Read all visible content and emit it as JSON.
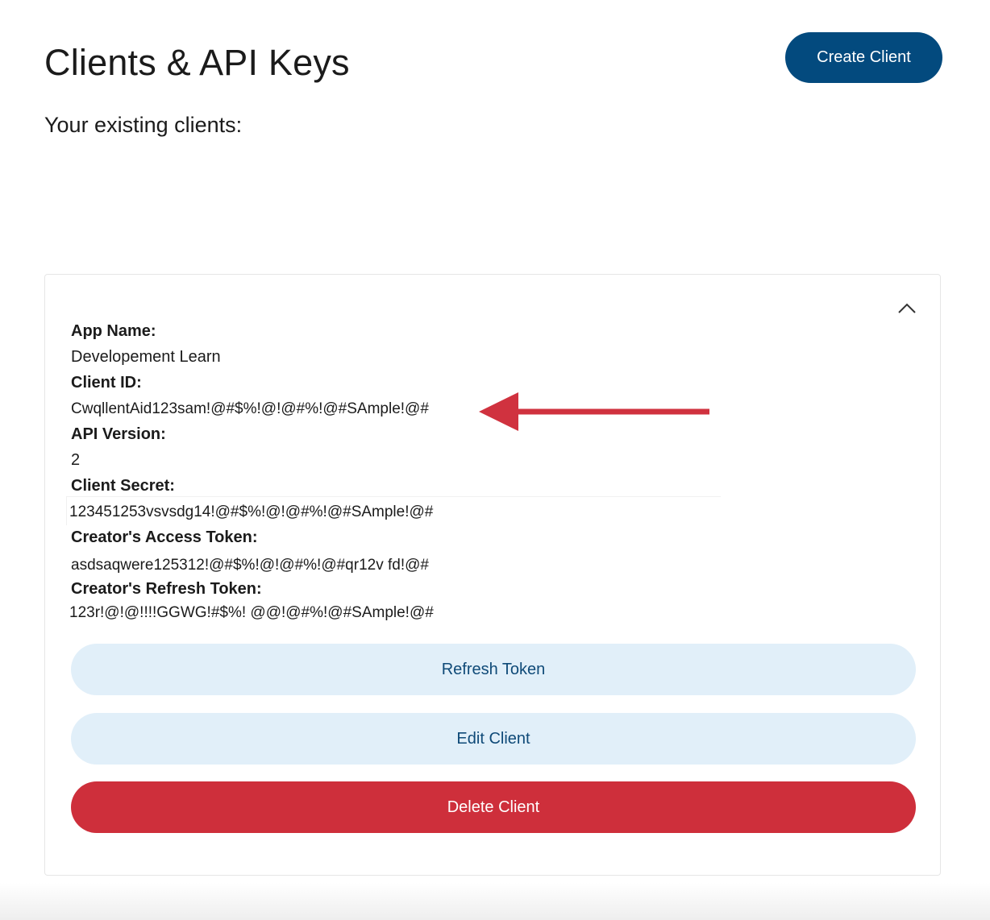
{
  "header": {
    "title": "Clients & API Keys",
    "create_label": "Create Client"
  },
  "subtitle": "Your existing clients:",
  "client_card": {
    "fields": [
      {
        "label": "App Name:",
        "value": "Developement Learn"
      },
      {
        "label": "Client ID:",
        "value": "CwqllentAid123sam!@#$%!@!@#%!@#SAmple!@#"
      },
      {
        "label": "API Version:",
        "value": "2"
      },
      {
        "label": "Client Secret:",
        "value": "123451253vsvsdg14!@#$%!@!@#%!@#SAmple!@#"
      },
      {
        "label": "Creator's Access Token:",
        "value": "asdsaqwere125312!@#$%!@!@#%!@#qr12v fd!@#"
      },
      {
        "label": "Creator's Refresh Token:",
        "value": "123r!@!@!!!!GGWG!#$%! @@!@#%!@#SAmple!@#"
      }
    ],
    "refresh_label": "Refresh Token",
    "edit_label": "Edit Client",
    "delete_label": "Delete Client",
    "toggle_icon": "chevron-up-icon"
  },
  "annotation": {
    "arrow_color": "#d0323f",
    "target": "Client ID"
  },
  "colors": {
    "primary": "#034a7e",
    "light_button": "#e1eff9",
    "danger": "#ce2f3b"
  }
}
